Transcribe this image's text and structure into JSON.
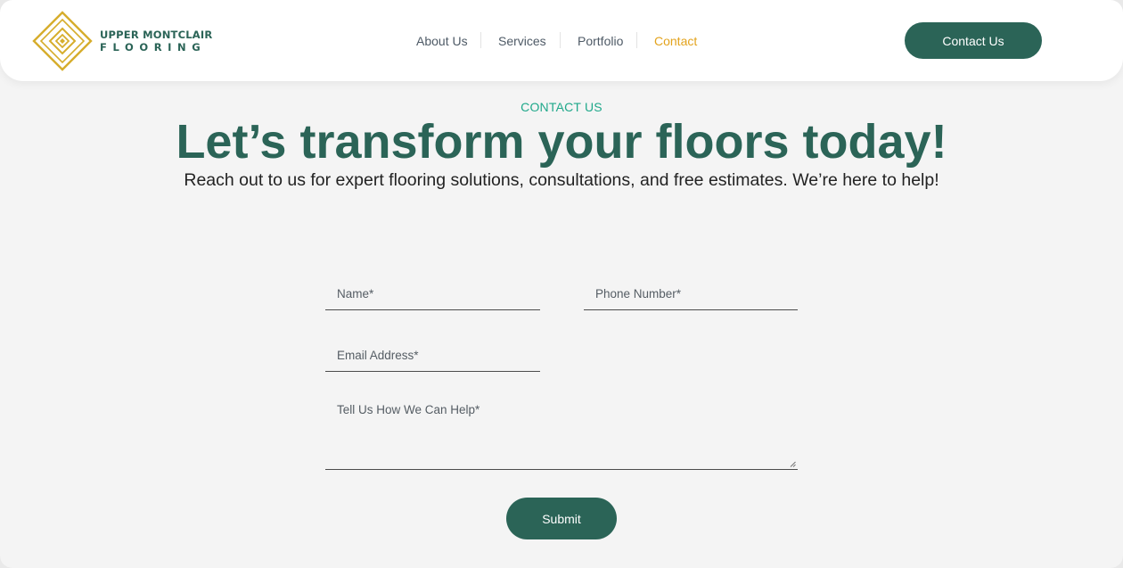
{
  "brand": {
    "name_line1": "UPPER MONTCLAIR",
    "name_line2": "FLOORING",
    "colors": {
      "primary": "#2b6457",
      "gold": "#d6ad2c",
      "accent_teal": "#1fa88a",
      "active_nav": "#e3a31d"
    }
  },
  "nav": {
    "items": [
      {
        "label": "About Us"
      },
      {
        "label": "Services"
      },
      {
        "label": "Portfolio"
      },
      {
        "label": "Contact"
      }
    ],
    "active": "Contact",
    "cta_label": "Contact Us"
  },
  "hero": {
    "eyebrow": "CONTACT US",
    "title": "Let’s transform your floors today!",
    "subtitle": "Reach out to us for expert flooring solutions, consultations, and free estimates. We’re here to help!"
  },
  "form": {
    "name": {
      "placeholder": "Name*",
      "value": ""
    },
    "phone": {
      "placeholder": "Phone Number*",
      "value": ""
    },
    "email": {
      "placeholder": "Email Address*",
      "value": ""
    },
    "message": {
      "placeholder": "Tell Us How We Can Help*",
      "value": ""
    },
    "submit_label": "Submit"
  }
}
